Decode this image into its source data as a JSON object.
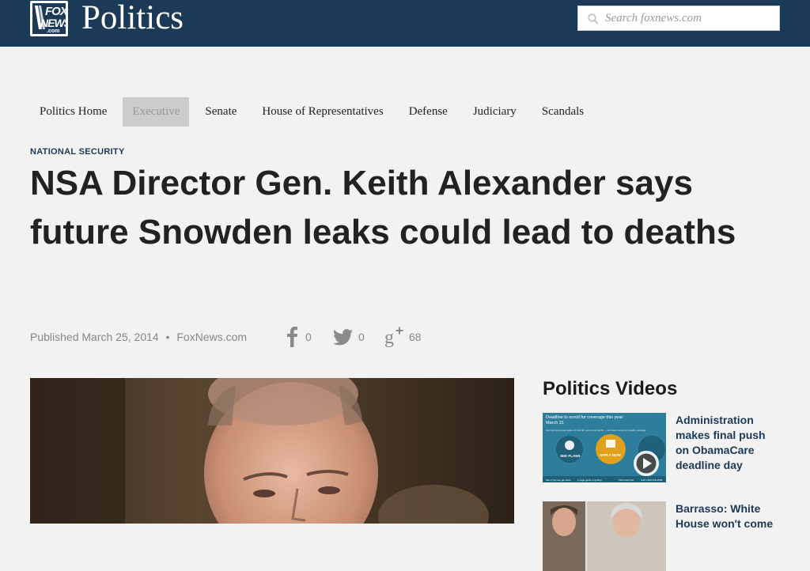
{
  "header": {
    "logo_line1": "FOX",
    "logo_line2": "NEWS",
    "logo_line3": ".com",
    "section_title": "Politics",
    "search_placeholder": "Search foxnews.com"
  },
  "nav": {
    "items": [
      {
        "label": "Politics Home",
        "active": false
      },
      {
        "label": "Executive",
        "active": true
      },
      {
        "label": "Senate",
        "active": false
      },
      {
        "label": "House of Representatives",
        "active": false
      },
      {
        "label": "Defense",
        "active": false
      },
      {
        "label": "Judiciary",
        "active": false
      },
      {
        "label": "Scandals",
        "active": false
      }
    ]
  },
  "article": {
    "kicker": "NATIONAL SECURITY",
    "headline": "NSA Director Gen. Keith Alexander says future Snowden leaks could lead to deaths",
    "published_label": "Published",
    "date": "March 25, 2014",
    "separator": "•",
    "source": "FoxNews.com"
  },
  "share": {
    "facebook_count": "0",
    "twitter_count": "0",
    "googleplus_count": "68"
  },
  "sidebar": {
    "title": "Politics Videos",
    "videos": [
      {
        "title": "Administration makes final push on ObamaCare deadline day"
      },
      {
        "title": "Barrasso: White House won't come"
      }
    ],
    "video1_thumb_text": {
      "top": "Deadline to enroll for coverage this year:",
      "date": "March 31",
      "line": "Get how to provide peace of mind for you & your family — and save money on quality coverage",
      "see_plans": "SEE PLANS",
      "apply_now": "APPLY NOW",
      "bottom1": "See if you can get lower",
      "bottom2": "1 page guide to getting",
      "bottom3": "Find local help",
      "bottom4": "Call 1-800-318-2596"
    }
  },
  "colors": {
    "header_bg": "#1b3a57",
    "page_bg": "#f2f2f2",
    "link_blue": "#1b3a57",
    "meta_gray": "#888888",
    "active_tab_bg": "#cccccc"
  }
}
